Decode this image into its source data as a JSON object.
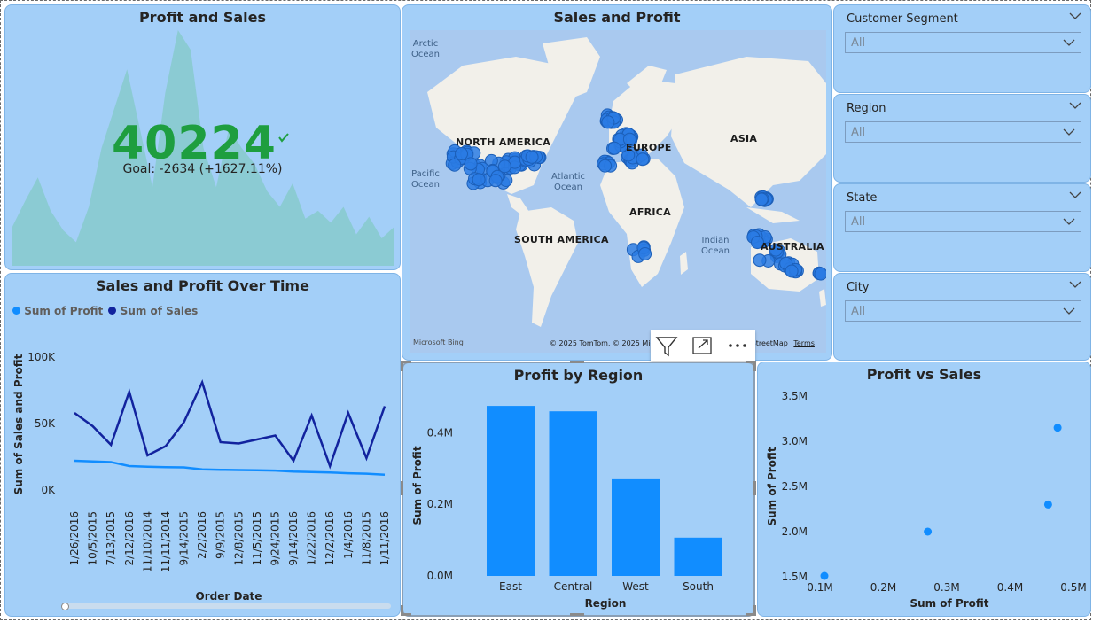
{
  "kpi": {
    "title": "Profit and Sales",
    "value": "40224",
    "goal_text": "Goal: -2634 (+1627.11%)",
    "status_color": "#1e9e3f",
    "trend_values": [
      20,
      33,
      45,
      28,
      18,
      12,
      30,
      60,
      80,
      100,
      70,
      40,
      88,
      120,
      110,
      60,
      40,
      70,
      60,
      52,
      38,
      30,
      42,
      24,
      28,
      22,
      30,
      16,
      25,
      14,
      20
    ]
  },
  "map": {
    "title": "Sales and Profit",
    "labels": {
      "north_america": "NORTH AMERICA",
      "europe": "EUROPE",
      "asia": "ASIA",
      "africa": "AFRICA",
      "south_america": "SOUTH AMERICA",
      "australia": "AUSTRALIA",
      "arctic_ocean": "Arctic Ocean",
      "atlantic_ocean": "Atlantic Ocean",
      "pacific_ocean": "Pacific Ocean",
      "indian_ocean": "Indian Ocean"
    },
    "attribution": "© 2025 TomTom, © 2025 Microsoft Corporation, © OpenStreetMap",
    "terms": "Terms",
    "bing": "Microsoft Bing",
    "dot_color": "#2a7be4"
  },
  "toolbar": {
    "filter_icon": "filter-icon",
    "focus_icon": "focus-mode-icon",
    "more_icon": "more-options-icon"
  },
  "slicers": [
    {
      "label": "Customer Segment",
      "value": "All"
    },
    {
      "label": "Region",
      "value": "All"
    },
    {
      "label": "State",
      "value": "All"
    },
    {
      "label": "City",
      "value": "All"
    }
  ],
  "line_chart": {
    "title": "Sales and Profit Over Time",
    "legend": [
      {
        "name": "Sum of Profit",
        "color": "#118dff"
      },
      {
        "name": "Sum of Sales",
        "color": "#12239e"
      }
    ],
    "chart_data": {
      "type": "line",
      "title": "Sales and Profit Over Time",
      "xlabel": "Order Date",
      "ylabel": "Sum of Sales and Profit",
      "ylim": [
        0,
        100000
      ],
      "yticks": [
        "0K",
        "50K",
        "100K"
      ],
      "categories": [
        "1/26/2016",
        "10/5/2015",
        "7/13/2015",
        "2/12/2016",
        "11/10/2014",
        "11/11/2014",
        "9/14/2015",
        "2/2/2016",
        "9/9/2015",
        "12/8/2015",
        "11/5/2015",
        "9/24/2015",
        "9/14/2016",
        "1/22/2016",
        "12/2/2016",
        "1/4/2016",
        "11/8/2015",
        "1/11/2016"
      ],
      "series": [
        {
          "name": "Sum of Sales",
          "color": "#12239e",
          "values": [
            58000,
            48000,
            34000,
            74000,
            26000,
            33000,
            51000,
            81000,
            36000,
            35000,
            38000,
            41000,
            22000,
            56000,
            18000,
            58000,
            24000,
            63000
          ]
        },
        {
          "name": "Sum of Profit",
          "color": "#118dff",
          "values": [
            22000,
            21500,
            21000,
            18000,
            17500,
            17200,
            17000,
            15500,
            15200,
            15000,
            14900,
            14600,
            13800,
            13500,
            13100,
            12600,
            12300,
            11500
          ]
        }
      ]
    }
  },
  "bar_chart": {
    "title": "Profit by Region",
    "chart_data": {
      "type": "bar",
      "title": "Profit by Region",
      "xlabel": "Region",
      "ylabel": "Sum of Profit",
      "ylim": [
        0,
        500000
      ],
      "yticks": [
        "0.0M",
        "0.2M",
        "0.4M"
      ],
      "categories": [
        "East",
        "Central",
        "West",
        "South"
      ],
      "values": [
        475000,
        460000,
        270000,
        107000
      ],
      "color": "#118dff"
    }
  },
  "scatter_chart": {
    "title": "Profit vs Sales",
    "chart_data": {
      "type": "scatter",
      "title": "Profit vs Sales",
      "xlabel": "Sum of Profit",
      "ylabel": "Sum of Profit",
      "xlim": [
        0.1,
        0.5
      ],
      "ylim": [
        1.5,
        3.5
      ],
      "xticks": [
        "0.1M",
        "0.2M",
        "0.3M",
        "0.4M",
        "0.5M"
      ],
      "yticks": [
        "1.5M",
        "2.0M",
        "2.5M",
        "3.0M",
        "3.5M"
      ],
      "points": [
        {
          "x": 0.107,
          "y": 1.51
        },
        {
          "x": 0.27,
          "y": 2.0
        },
        {
          "x": 0.46,
          "y": 2.3
        },
        {
          "x": 0.475,
          "y": 3.15
        }
      ],
      "color": "#118dff"
    }
  }
}
